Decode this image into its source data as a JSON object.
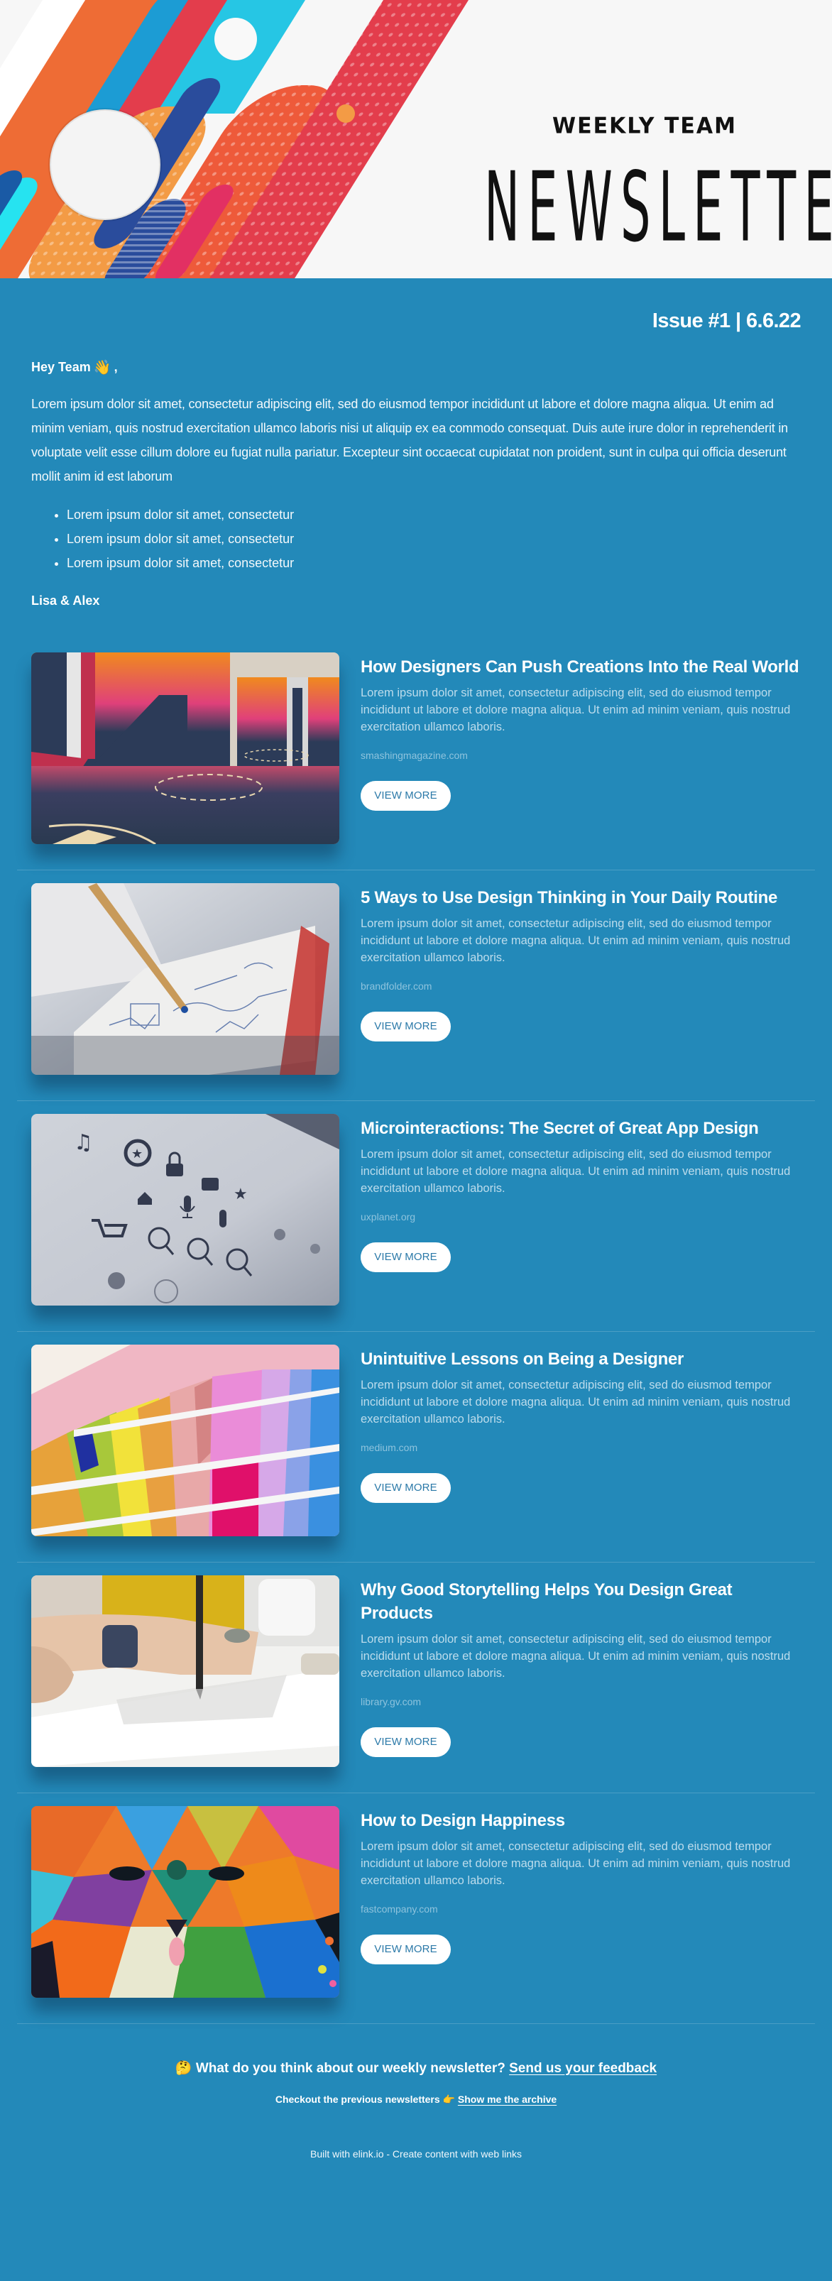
{
  "banner": {
    "kicker": "WEEKLY TEAM",
    "title": "NEWSLETTER",
    "colors": {
      "orange": "#ee6c35",
      "red": "#e33d4c",
      "blue": "#1c9cd4",
      "navy": "#2a4c9c",
      "cyan": "#26d3e8",
      "peach": "#f39b45",
      "pink": "#e23063"
    }
  },
  "intro": {
    "issue": "Issue #1 | 6.6.22",
    "greeting": "Hey Team",
    "greeting_emoji": "👋",
    "greeting_suffix": ",",
    "paragraph": "Lorem ipsum dolor sit amet, consectetur adipiscing elit, sed do eiusmod tempor incididunt ut labore et dolore magna aliqua. Ut enim ad minim veniam, quis nostrud exercitation ullamco laboris nisi ut aliquip ex ea commodo consequat. Duis aute irure dolor in reprehenderit in voluptate velit esse cillum dolore eu fugiat nulla pariatur. Excepteur sint occaecat cupidatat non proident, sunt in culpa qui officia deserunt mollit anim id est laborum",
    "bullets": [
      "Lorem ipsum dolor sit amet, consectetur",
      "Lorem ipsum dolor sit amet, consectetur",
      "Lorem ipsum dolor sit amet, consectetur"
    ],
    "signature": "Lisa & Alex"
  },
  "articles": [
    {
      "title": "How Designers Can Push Creations Into the Real World",
      "description": "Lorem ipsum dolor sit amet, consectetur adipiscing elit, sed do eiusmod tempor incididunt ut labore et dolore magna aliqua. Ut enim ad minim veniam, quis nostrud exercitation ullamco laboris.",
      "source": "smashingmagazine.com",
      "button": "VIEW MORE",
      "image": "colorful-basketball-court"
    },
    {
      "title": "5 Ways to Use Design Thinking in Your Daily Routine",
      "description": "Lorem ipsum dolor sit amet, consectetur adipiscing elit, sed do eiusmod tempor incididunt ut labore et dolore magna aliqua. Ut enim ad minim veniam, quis nostrud exercitation ullamco laboris.",
      "source": "brandfolder.com",
      "button": "VIEW MORE",
      "image": "sketch-notebook-with-pencil"
    },
    {
      "title": "Microinteractions: The Secret of Great App Design",
      "description": "Lorem ipsum dolor sit amet, consectetur adipiscing elit, sed do eiusmod tempor incididunt ut labore et dolore magna aliqua. Ut enim ad minim veniam, quis nostrud exercitation ullamco laboris.",
      "source": "uxplanet.org",
      "button": "VIEW MORE",
      "image": "icon-set-on-screen"
    },
    {
      "title": "Unintuitive Lessons on Being a Designer",
      "description": "Lorem ipsum dolor sit amet, consectetur adipiscing elit, sed do eiusmod tempor incididunt ut labore et dolore magna aliqua. Ut enim ad minim veniam, quis nostrud exercitation ullamco laboris.",
      "source": "medium.com",
      "button": "VIEW MORE",
      "image": "pantone-color-swatches"
    },
    {
      "title": "Why Good Storytelling Helps You Design Great Products",
      "description": "Lorem ipsum dolor sit amet, consectetur adipiscing elit, sed do eiusmod tempor incididunt ut labore et dolore magna aliqua. Ut enim ad minim veniam, quis nostrud exercitation ullamco laboris.",
      "source": "library.gv.com",
      "button": "VIEW MORE",
      "image": "hand-drawing-with-pen"
    },
    {
      "title": "How to Design Happiness",
      "description": "Lorem ipsum dolor sit amet, consectetur adipiscing elit, sed do eiusmod tempor incididunt ut labore et dolore magna aliqua. Ut enim ad minim veniam, quis nostrud exercitation ullamco laboris.",
      "source": "fastcompany.com",
      "button": "VIEW MORE",
      "image": "geometric-bear-mural"
    }
  ],
  "footer": {
    "feedback_emoji": "🤔",
    "feedback_text": "What do you think about our weekly newsletter?",
    "feedback_link": "Send us your feedback",
    "archive_text": "Checkout the previous newsletters",
    "archive_emoji": "👉",
    "archive_link": "Show me the archive",
    "built_with": "Built with elink.io - Create content with web links"
  },
  "theme": {
    "background": "#2389b9",
    "button_text": "#2b79a8",
    "description_text": "#bcdcec",
    "source_text": "#8ec3dd"
  }
}
